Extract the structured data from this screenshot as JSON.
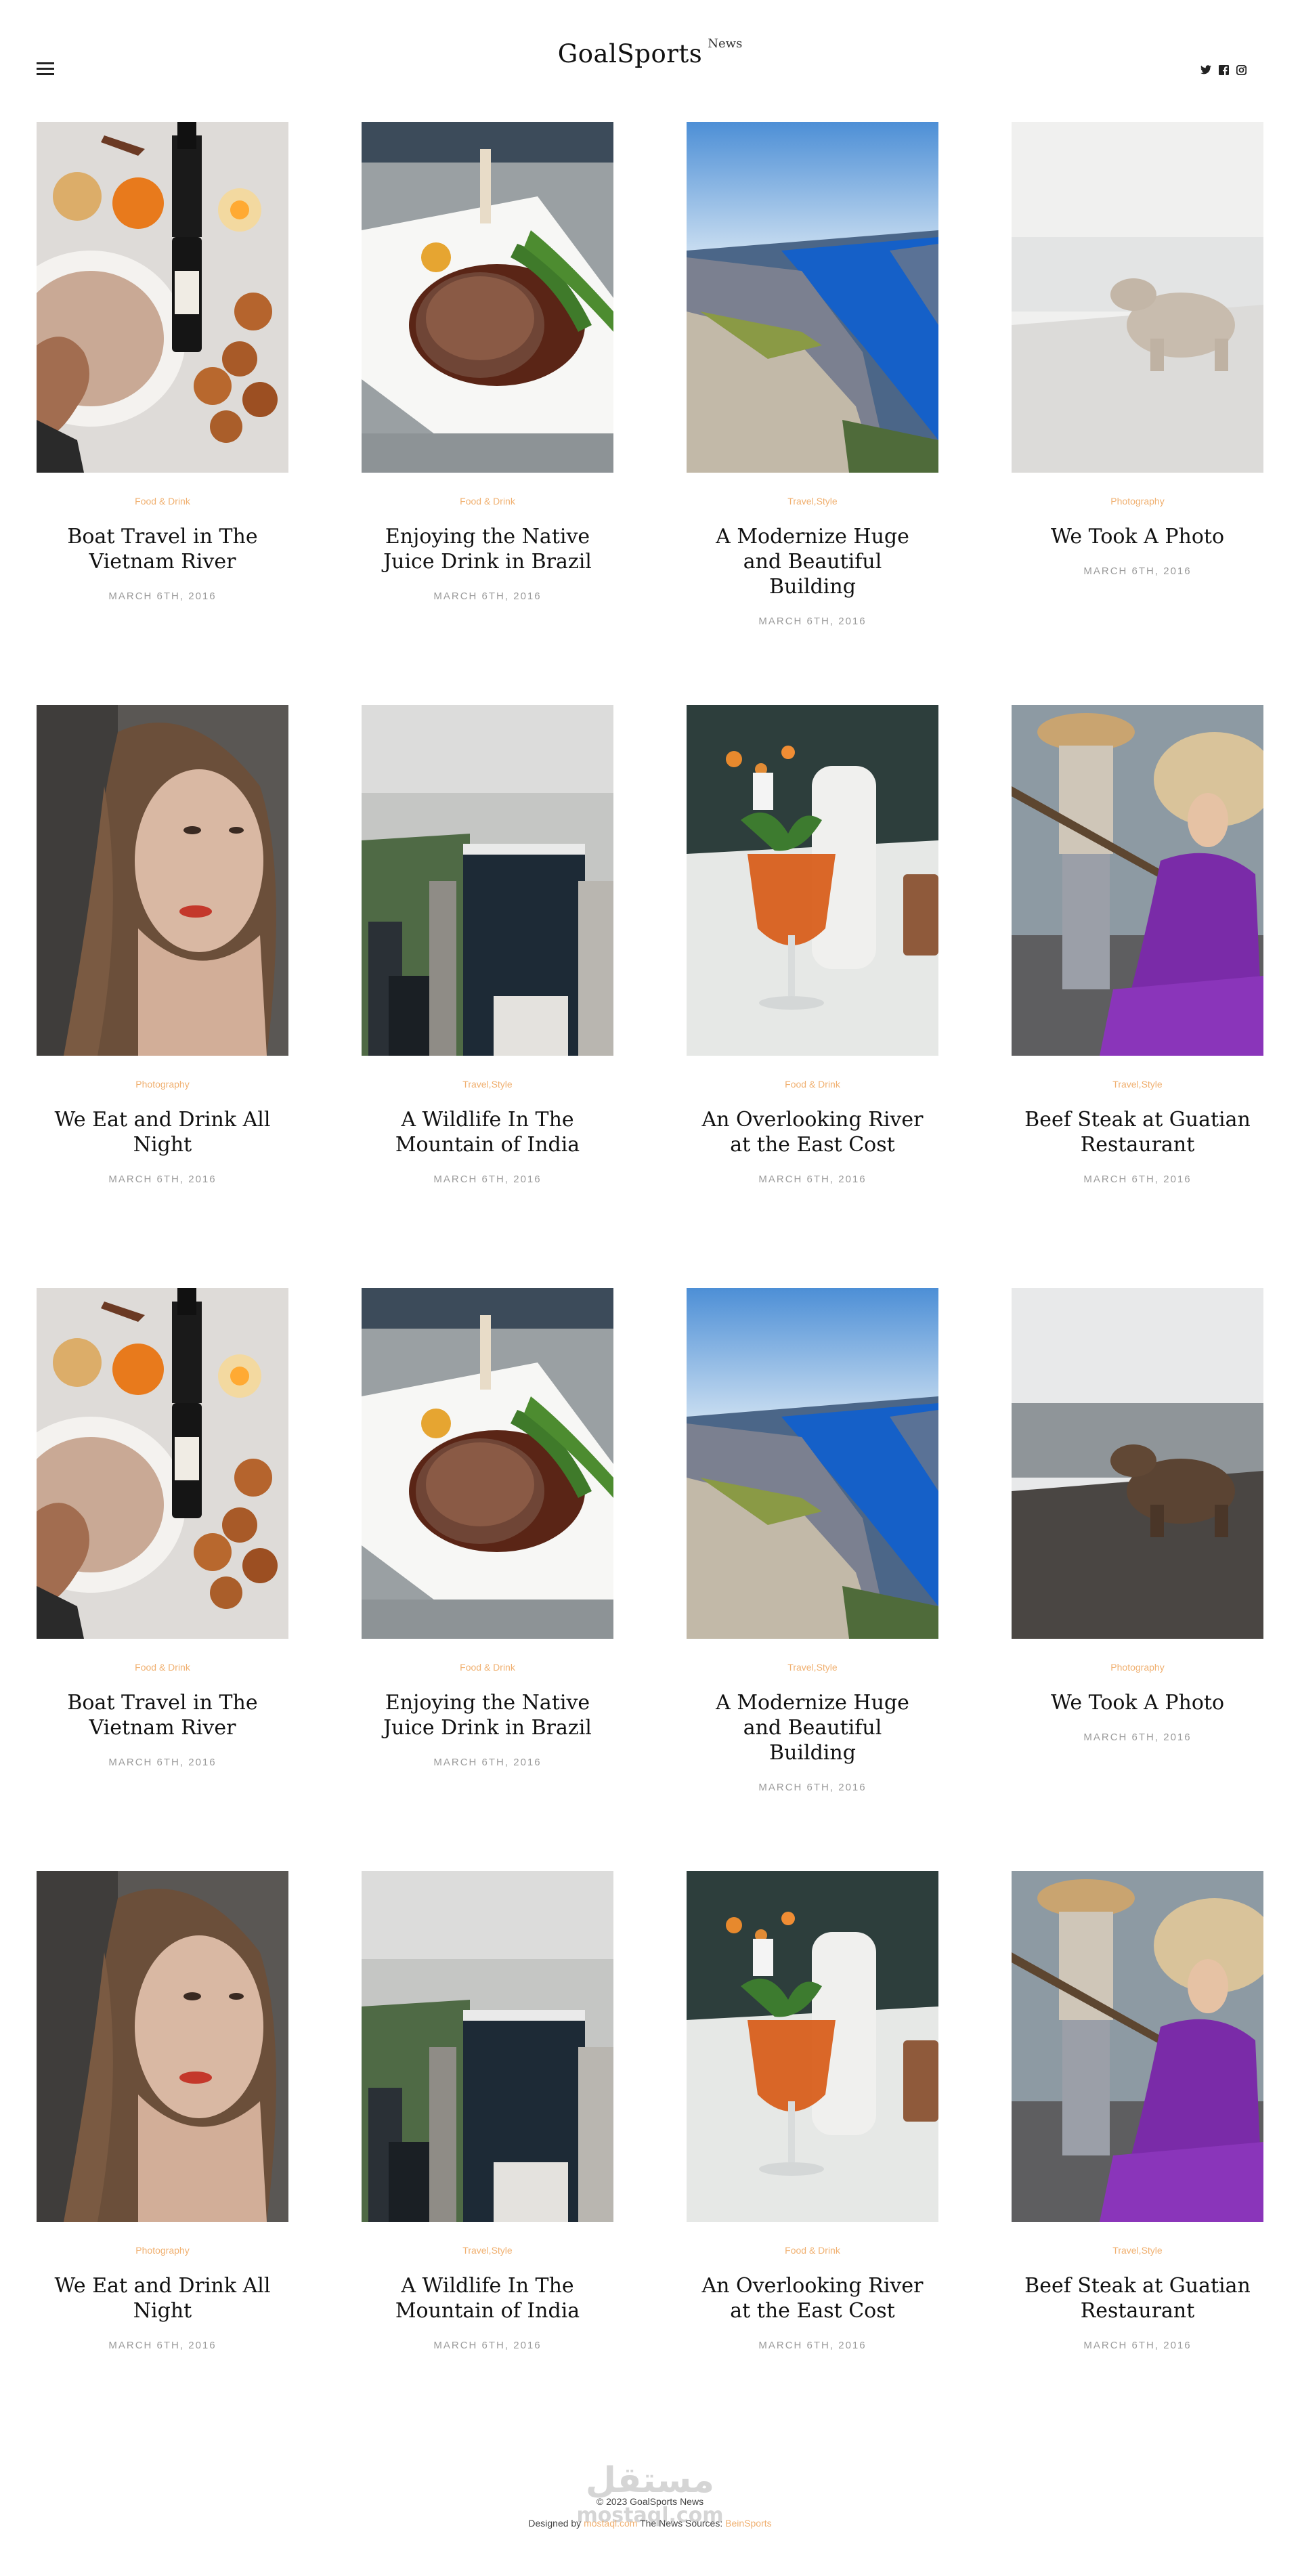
{
  "header": {
    "logo_main": "GoalSports",
    "logo_sup": "News"
  },
  "colors": {
    "accent": "#f0b070",
    "date": "#9a9a9a",
    "title": "#111111"
  },
  "posts": [
    {
      "category": "Food & Drink",
      "title": "Boat Travel in The Vietnam River",
      "date": "MARCH 6TH, 2016",
      "image": "wine-food-flatlay"
    },
    {
      "category": "Food & Drink",
      "title": "Enjoying the Native Juice Drink in Brazil",
      "date": "MARCH 6TH, 2016",
      "image": "steak-plate"
    },
    {
      "category": "Travel,Style",
      "title": "A Modernize Huge and Beautiful Building",
      "date": "MARCH 6TH, 2016",
      "image": "fjord-cliff"
    },
    {
      "category": "Photography",
      "title": "We Took A Photo",
      "date": "MARCH 6TH, 2016",
      "image": "bear-faded"
    },
    {
      "category": "Photography",
      "title": "We Eat and Drink All Night",
      "date": "MARCH 6TH, 2016",
      "image": "woman-portrait"
    },
    {
      "category": "Travel,Style",
      "title": "A Wildlife In The Mountain of India",
      "date": "MARCH 6TH, 2016",
      "image": "city-skyscraper"
    },
    {
      "category": "Food & Drink",
      "title": "An Overlooking River at the East Cost",
      "date": "MARCH 6TH, 2016",
      "image": "cocktail-drink"
    },
    {
      "category": "Travel,Style",
      "title": "Beef Steak at Guatian Restaurant",
      "date": "MARCH 6TH, 2016",
      "image": "vietnam-woman"
    },
    {
      "category": "Food & Drink",
      "title": "Boat Travel in The Vietnam River",
      "date": "MARCH 6TH, 2016",
      "image": "wine-food-flatlay"
    },
    {
      "category": "Food & Drink",
      "title": "Enjoying the Native Juice Drink in Brazil",
      "date": "MARCH 6TH, 2016",
      "image": "steak-plate"
    },
    {
      "category": "Travel,Style",
      "title": "A Modernize Huge and Beautiful Building",
      "date": "MARCH 6TH, 2016",
      "image": "fjord-cliff"
    },
    {
      "category": "Photography",
      "title": "We Took A Photo",
      "date": "MARCH 6TH, 2016",
      "image": "bear"
    },
    {
      "category": "Photography",
      "title": "We Eat and Drink All Night",
      "date": "MARCH 6TH, 2016",
      "image": "woman-portrait"
    },
    {
      "category": "Travel,Style",
      "title": "A Wildlife In The Mountain of India",
      "date": "MARCH 6TH, 2016",
      "image": "city-skyscraper"
    },
    {
      "category": "Food & Drink",
      "title": "An Overlooking River at the East Cost",
      "date": "MARCH 6TH, 2016",
      "image": "cocktail-drink"
    },
    {
      "category": "Travel,Style",
      "title": "Beef Steak at Guatian Restaurant",
      "date": "MARCH 6TH, 2016",
      "image": "vietnam-woman"
    }
  ],
  "footer": {
    "watermark": "mostaql.com",
    "copyright": "© 2023 GoalSports News",
    "designed_by_prefix": "Designed by",
    "designer": "mostaql.com",
    "sources_prefix": "The News Sources:",
    "source_link": "BeinSports"
  }
}
